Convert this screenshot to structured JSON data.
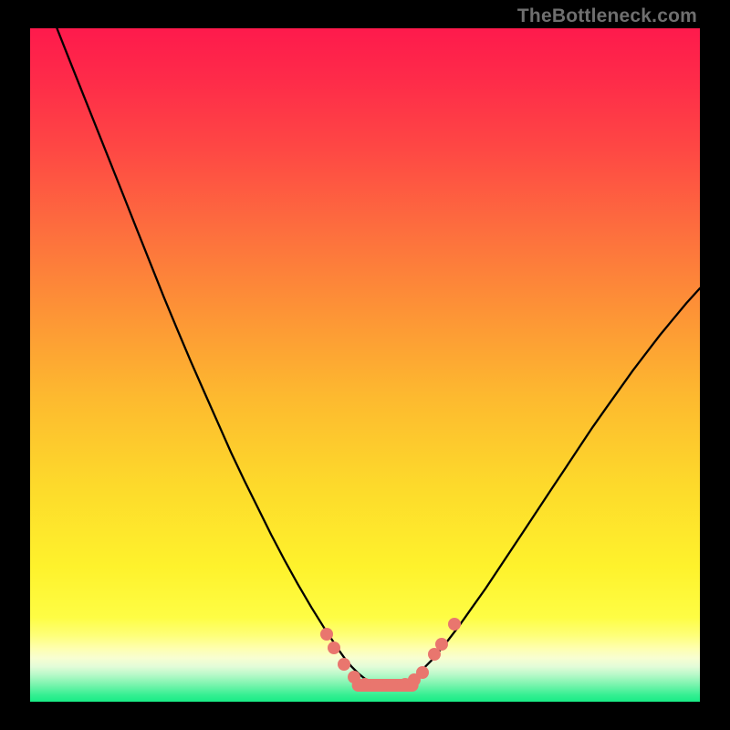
{
  "watermark": "TheBottleneck.com",
  "colors": {
    "frame": "#000000",
    "watermark_text": "#6f6f6f",
    "curve": "#000000",
    "marker": "#e9766e",
    "gradient_stops": [
      {
        "offset": 0.0,
        "color": "#fe1a4c"
      },
      {
        "offset": 0.08,
        "color": "#fe2c49"
      },
      {
        "offset": 0.18,
        "color": "#fe4844"
      },
      {
        "offset": 0.3,
        "color": "#fd6e3e"
      },
      {
        "offset": 0.42,
        "color": "#fd9336"
      },
      {
        "offset": 0.55,
        "color": "#fdba2f"
      },
      {
        "offset": 0.68,
        "color": "#fdda2b"
      },
      {
        "offset": 0.8,
        "color": "#fef22c"
      },
      {
        "offset": 0.875,
        "color": "#fefd44"
      },
      {
        "offset": 0.902,
        "color": "#feff7a"
      },
      {
        "offset": 0.92,
        "color": "#feffad"
      },
      {
        "offset": 0.935,
        "color": "#f8fed1"
      },
      {
        "offset": 0.948,
        "color": "#e2fcd8"
      },
      {
        "offset": 0.96,
        "color": "#b7f9c8"
      },
      {
        "offset": 0.975,
        "color": "#78f4ad"
      },
      {
        "offset": 0.99,
        "color": "#35ef92"
      },
      {
        "offset": 1.0,
        "color": "#18ec86"
      }
    ]
  },
  "chart_data": {
    "type": "line",
    "title": "",
    "xlabel": "",
    "ylabel": "",
    "xlim": [
      0,
      100
    ],
    "ylim": [
      0,
      100
    ],
    "grid": false,
    "legend": false,
    "note": "Values are estimated from pixel positions; y is normalized 0=bottom 100=top of plot area.",
    "series": [
      {
        "name": "curve",
        "x": [
          4.0,
          6.0,
          8.0,
          10.0,
          12.0,
          14.0,
          16.0,
          18.0,
          20.0,
          22.0,
          24.0,
          26.0,
          28.0,
          30.0,
          32.0,
          34.0,
          36.0,
          38.0,
          40.0,
          42.0,
          44.0,
          46.0,
          47.0,
          48.0,
          49.0,
          50.0,
          51.0,
          52.0,
          53.0,
          54.0,
          55.0,
          56.0,
          57.0,
          58.0,
          60.0,
          62.0,
          64.0,
          66.0,
          68.0,
          70.0,
          72.0,
          74.0,
          76.0,
          78.0,
          80.0,
          82.0,
          84.0,
          86.0,
          88.0,
          90.0,
          92.0,
          94.0,
          96.0,
          98.0,
          100.0
        ],
        "y": [
          100.0,
          95.0,
          90.0,
          85.0,
          80.0,
          75.0,
          70.0,
          65.0,
          60.0,
          55.2,
          50.5,
          46.0,
          41.5,
          37.0,
          32.8,
          28.8,
          24.8,
          21.0,
          17.4,
          14.0,
          10.8,
          7.8,
          6.4,
          5.2,
          4.2,
          3.4,
          2.8,
          2.4,
          2.2,
          2.2,
          2.4,
          2.8,
          3.4,
          4.2,
          6.2,
          8.6,
          11.2,
          14.0,
          16.8,
          19.8,
          22.8,
          25.8,
          28.8,
          31.8,
          34.8,
          37.8,
          40.8,
          43.6,
          46.4,
          49.2,
          51.8,
          54.4,
          56.8,
          59.2,
          61.4
        ]
      }
    ],
    "markers_cluster_x_range": [
      44.0,
      63.0
    ],
    "markers": [
      {
        "x": 44.3,
        "y": 10.0
      },
      {
        "x": 45.3,
        "y": 8.0
      },
      {
        "x": 46.8,
        "y": 5.6
      },
      {
        "x": 48.3,
        "y": 3.6
      },
      {
        "x": 50.0,
        "y": 2.6
      },
      {
        "x": 52.0,
        "y": 2.4
      },
      {
        "x": 54.0,
        "y": 2.4
      },
      {
        "x": 56.0,
        "y": 2.6
      },
      {
        "x": 57.4,
        "y": 3.2
      },
      {
        "x": 58.6,
        "y": 4.4
      },
      {
        "x": 60.4,
        "y": 7.0
      },
      {
        "x": 61.4,
        "y": 8.5
      },
      {
        "x": 63.3,
        "y": 11.5
      }
    ]
  }
}
